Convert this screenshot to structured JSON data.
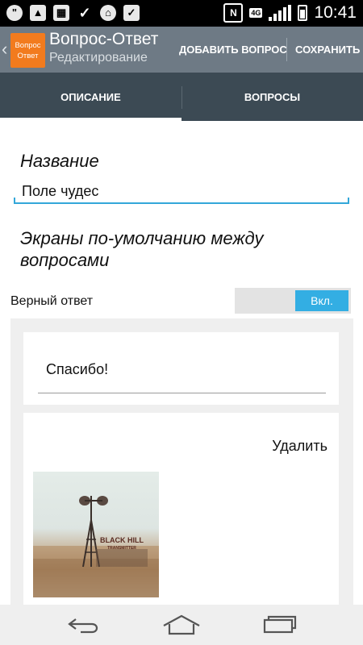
{
  "status_bar": {
    "time": "10:41",
    "network": "4G",
    "nfc": "N",
    "notification_icons": [
      "quote-icon",
      "image-icon",
      "gallery-icon",
      "check-icon",
      "tag-icon",
      "briefcase-icon"
    ],
    "battery_level": 0.7
  },
  "action_bar": {
    "app_icon_line1": "Вопрос",
    "app_icon_line2": "Ответ",
    "title": "Вопрос-Ответ",
    "subtitle": "Редактирование",
    "add_question_label": "ДОБАВИТЬ ВОПРОС",
    "save_label": "СОХРАНИТЬ"
  },
  "tabs": [
    {
      "label": "ОПИСАНИЕ",
      "active": true
    },
    {
      "label": "ВОПРОСЫ",
      "active": false
    }
  ],
  "form": {
    "name_label": "Название",
    "name_value": "Поле чудес",
    "screens_label": "Экраны по-умолчанию между вопросами",
    "correct_answer_label": "Верный ответ",
    "toggle_label": "Вкл.",
    "toggle_on": true,
    "thanks_value": "Спасибо!",
    "delete_label": "Удалить",
    "image_caption_line1": "BLACK HILL",
    "image_caption_line2": "TRANSMITTER"
  },
  "colors": {
    "action_bar": "#6e7a85",
    "tab_bar": "#3c4a54",
    "accent": "#33aee3",
    "app_icon": "#f27b1e"
  }
}
